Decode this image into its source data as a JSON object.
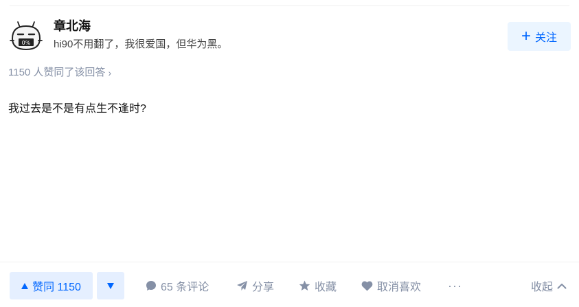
{
  "author": {
    "name": "章北海",
    "headline": "hi90不用翻了，我很爱国，但华为黑。",
    "avatar_text": "0%",
    "follow_label": "关注"
  },
  "answer": {
    "upvote_meta": "1150 人赞同了该回答",
    "content": "我过去是不是有点生不逢时?"
  },
  "actions": {
    "upvote_label": "赞同 1150",
    "comments_label": "65 条评论",
    "share_label": "分享",
    "favorite_label": "收藏",
    "unlike_label": "取消喜欢",
    "more_label": "···",
    "collapse_label": "收起"
  },
  "colors": {
    "accent": "#0066ff",
    "accent_bg": "#ebf5ff",
    "muted": "#8590a6"
  }
}
